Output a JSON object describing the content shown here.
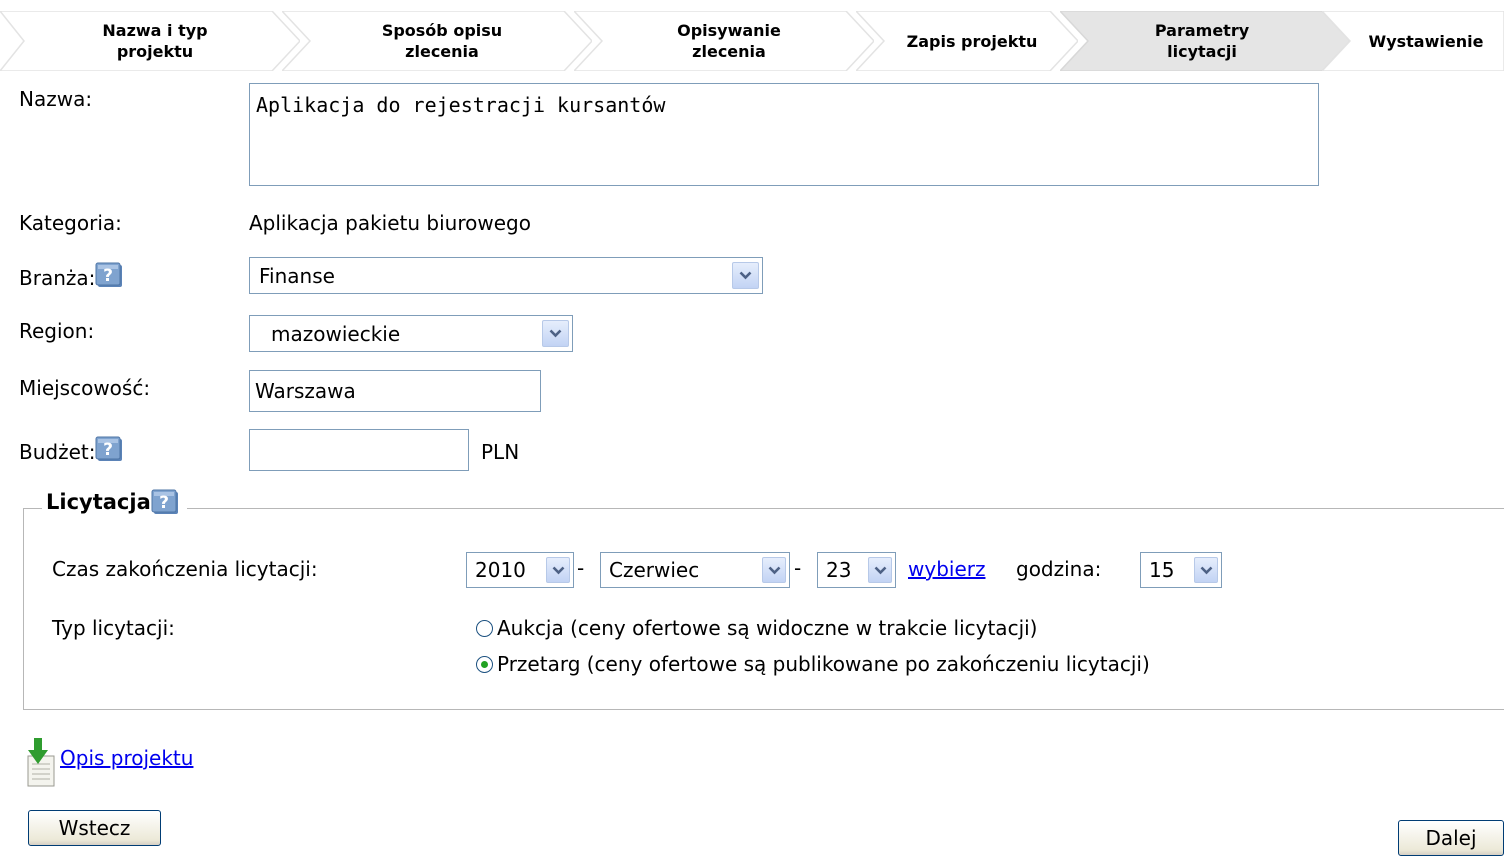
{
  "wizard": {
    "steps": [
      {
        "label": "Nazwa i typ projektu",
        "active": false
      },
      {
        "label": "Sposób opisu zlecenia",
        "active": false
      },
      {
        "label": "Opisywanie zlecenia",
        "active": false
      },
      {
        "label": "Zapis projektu",
        "active": false
      },
      {
        "label": "Parametry licytacji",
        "active": true
      },
      {
        "label": "Wystawienie",
        "active": false
      }
    ]
  },
  "form": {
    "name_label": "Nazwa:",
    "name_value": "Aplikacja do rejestracji kursantów",
    "category_label": "Kategoria:",
    "category_value": "Aplikacja pakietu biurowego",
    "industry_label": "Branża:",
    "industry_value": "Finanse",
    "region_label": "Region:",
    "region_value": "mazowieckie",
    "city_label": "Miejscowość:",
    "city_value": "Warszawa",
    "budget_label": "Budżet:",
    "budget_value": "",
    "budget_unit": "PLN"
  },
  "auction": {
    "legend": "Licytacja",
    "end_time_label": "Czas zakończenia licytacji:",
    "year": "2010",
    "month": "Czerwiec",
    "day": "23",
    "dash": "-",
    "choose_link": "wybierz",
    "hour_label": "godzina:",
    "hour": "15",
    "type_label": "Typ licytacji:",
    "options": [
      {
        "label": "Aukcja (ceny ofertowe są widoczne w trakcie licytacji)",
        "selected": false
      },
      {
        "label": "Przetarg (ceny ofertowe są publikowane po zakończeniu licytacji)",
        "selected": true
      }
    ]
  },
  "footer": {
    "description_link": "Opis projektu",
    "back_button": "Wstecz",
    "next_button": "Dalej"
  },
  "colors": {
    "input_border": "#7f9db9",
    "link": "#0000ee",
    "active_step": "#e5e5e5",
    "radio_selected": "#21a121"
  },
  "icons": {
    "help": "help-icon",
    "download": "download-document-icon",
    "dropdown": "chevron-down-icon"
  }
}
